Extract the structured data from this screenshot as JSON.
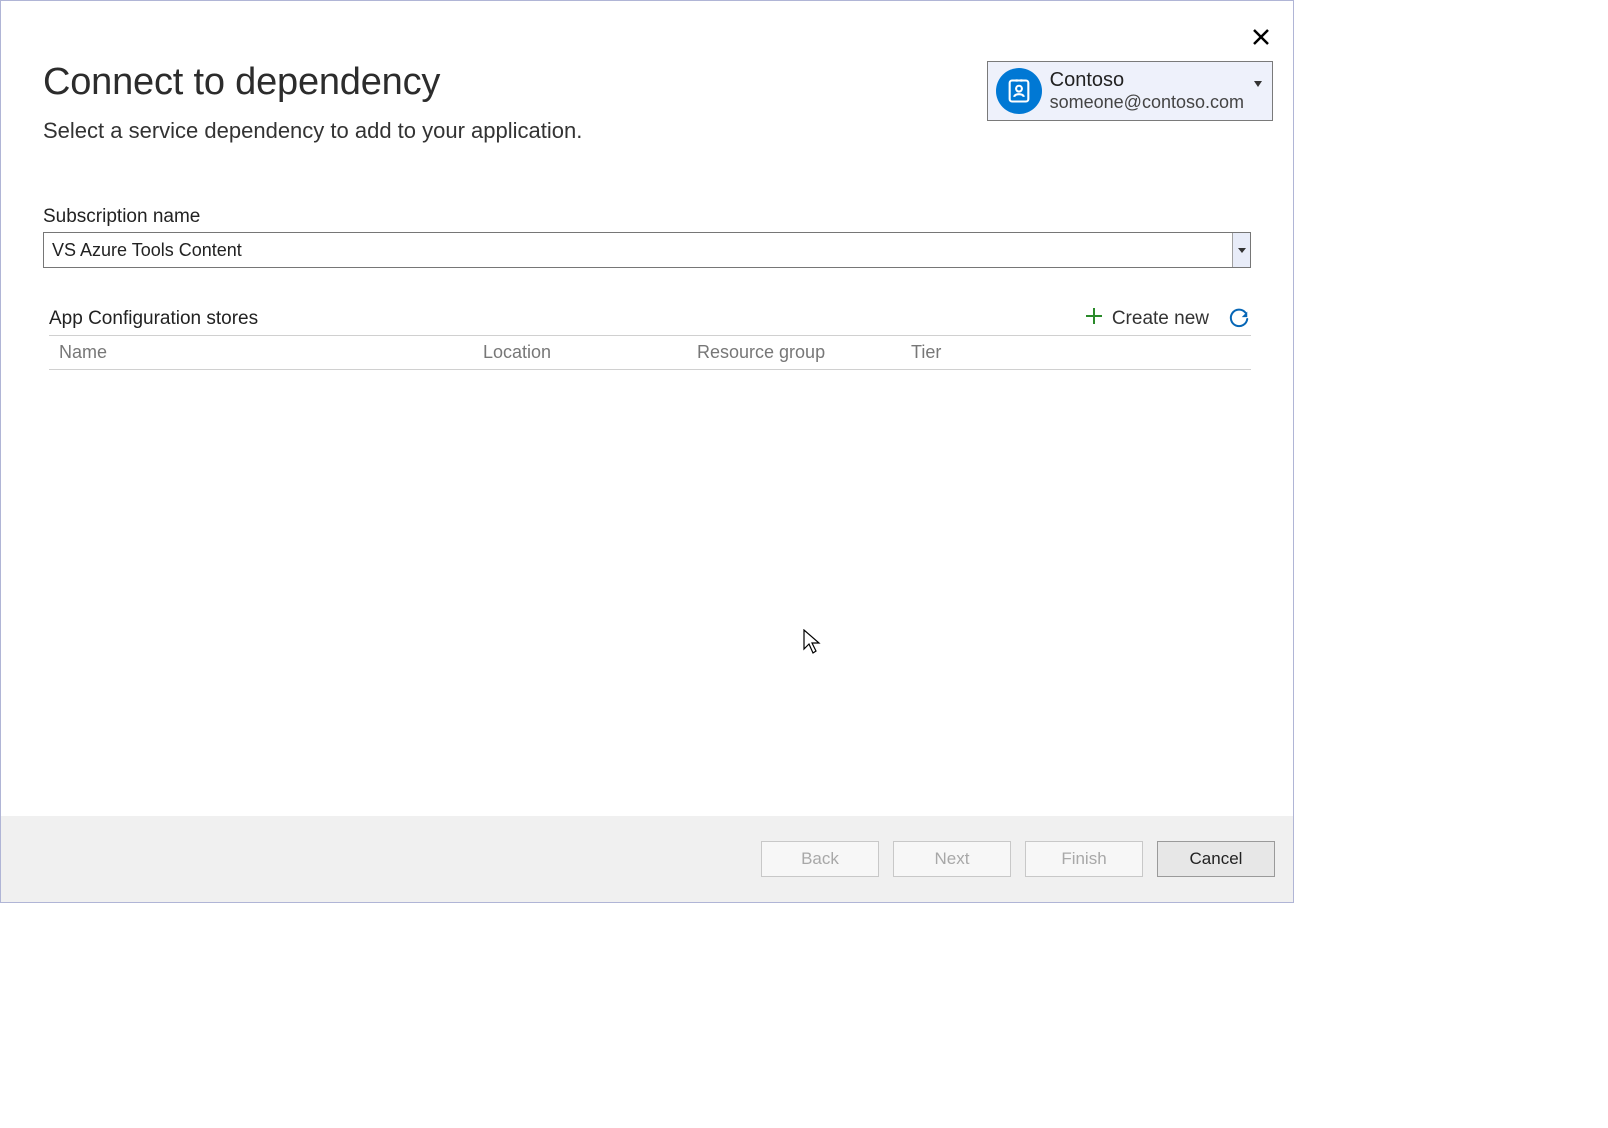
{
  "header": {
    "title": "Connect to dependency",
    "subtitle": "Select a service dependency to add to your application."
  },
  "account": {
    "name": "Contoso",
    "email": "someone@contoso.com"
  },
  "subscription": {
    "label": "Subscription name",
    "value": "VS Azure Tools Content"
  },
  "section": {
    "title": "App Configuration stores",
    "create_new": "Create new"
  },
  "columns": {
    "name": "Name",
    "location": "Location",
    "resource_group": "Resource group",
    "tier": "Tier"
  },
  "buttons": {
    "back": "Back",
    "next": "Next",
    "finish": "Finish",
    "cancel": "Cancel"
  }
}
